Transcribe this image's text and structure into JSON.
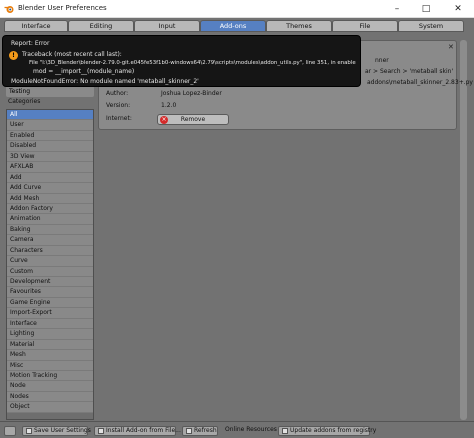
{
  "window": {
    "title": "Blender User Preferences",
    "minimize_glyph": "–",
    "maximize_glyph": "□",
    "close_glyph": "✕"
  },
  "tabs": [
    {
      "label": "Interface"
    },
    {
      "label": "Editing"
    },
    {
      "label": "Input"
    },
    {
      "label": "Add-ons",
      "active": true
    },
    {
      "label": "Themes"
    },
    {
      "label": "File"
    },
    {
      "label": "System"
    }
  ],
  "sidebar": {
    "testing_label": "Testing",
    "categories_label": "Categories",
    "categories": [
      "All",
      "User",
      "Enabled",
      "Disabled",
      "3D View",
      "AFXLAB",
      "Add",
      "Add Curve",
      "Add Mesh",
      "Addon Factory",
      "Animation",
      "Baking",
      "Camera",
      "Characters",
      "Curve",
      "Custom",
      "Development",
      "Favourites",
      "Game Engine",
      "Import-Export",
      "Interface",
      "Lighting",
      "Material",
      "Mesh",
      "Misc",
      "Motion Tracking",
      "Node",
      "Nodes",
      "Object"
    ],
    "active_category": "All"
  },
  "error": {
    "header": "Report: Error",
    "icon": "!",
    "traceback_label": "Traceback (most recent call last):",
    "file_line": "File \"I:\\3D_Blender\\blender-2.79.0-git.e045fe53f1b0-windows64\\2.79\\scripts\\modules\\addon_utils.py\", line 351, in enable",
    "code_line": "mod = __import__(module_name)",
    "message": "ModuleNotFoundError: No module named 'metaball_skinner_2'"
  },
  "addon": {
    "partial_name": "nner",
    "partial_location": "ar > Search > 'metaball skin'",
    "partial_file": "addons\\metaball_skinner_2.83+.py",
    "author_label": "Author:",
    "author": "Joshua Lopez-Binder",
    "version_label": "Version:",
    "version": "1.2.0",
    "internet_label": "Internet:",
    "remove_label": "Remove",
    "close_glyph": "✕"
  },
  "bottom": {
    "save_label": "Save User Settings",
    "install_label": "Install Add-on from File...",
    "refresh_label": "Refresh",
    "online_label": "Online Resources",
    "update_label": "Update addons from registry"
  }
}
